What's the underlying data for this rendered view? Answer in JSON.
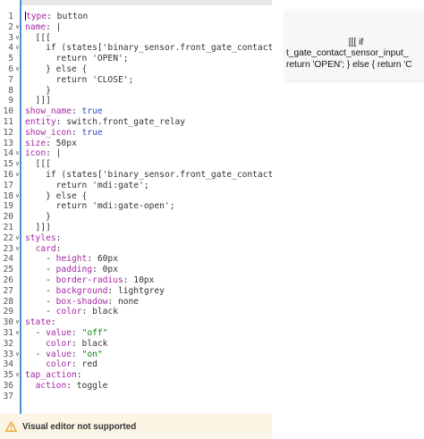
{
  "editor": {
    "lines": [
      {
        "n": "1",
        "fold": "",
        "parts": [
          [
            "k",
            "type"
          ],
          [
            "p",
            ": "
          ],
          [
            "p",
            "button"
          ]
        ],
        "cursor": true
      },
      {
        "n": "2",
        "fold": "v",
        "parts": [
          [
            "k",
            "name"
          ],
          [
            "p",
            ": |"
          ]
        ]
      },
      {
        "n": "3",
        "fold": "v",
        "parts": [
          [
            "p",
            "  [[["
          ]
        ]
      },
      {
        "n": "4",
        "fold": "v",
        "parts": [
          [
            "p",
            "    if (states['binary_sensor.front_gate_contact_s"
          ]
        ]
      },
      {
        "n": "5",
        "fold": "",
        "parts": [
          [
            "p",
            "      return 'OPEN';"
          ]
        ]
      },
      {
        "n": "6",
        "fold": "v",
        "parts": [
          [
            "p",
            "    } else {"
          ]
        ]
      },
      {
        "n": "7",
        "fold": "",
        "parts": [
          [
            "p",
            "      return 'CLOSE';"
          ]
        ]
      },
      {
        "n": "8",
        "fold": "",
        "parts": [
          [
            "p",
            "    }"
          ]
        ]
      },
      {
        "n": "9",
        "fold": "",
        "parts": [
          [
            "p",
            "  ]]]"
          ]
        ]
      },
      {
        "n": "10",
        "fold": "",
        "parts": [
          [
            "k",
            "show_name"
          ],
          [
            "p",
            ": "
          ],
          [
            "b",
            "true"
          ]
        ]
      },
      {
        "n": "11",
        "fold": "",
        "parts": [
          [
            "k",
            "entity"
          ],
          [
            "p",
            ": switch.front_gate_relay"
          ]
        ]
      },
      {
        "n": "12",
        "fold": "",
        "parts": [
          [
            "k",
            "show_icon"
          ],
          [
            "p",
            ": "
          ],
          [
            "b",
            "true"
          ]
        ]
      },
      {
        "n": "13",
        "fold": "",
        "parts": [
          [
            "k",
            "size"
          ],
          [
            "p",
            ": 50px"
          ]
        ]
      },
      {
        "n": "14",
        "fold": "v",
        "parts": [
          [
            "k",
            "icon"
          ],
          [
            "p",
            ": |"
          ]
        ]
      },
      {
        "n": "15",
        "fold": "v",
        "parts": [
          [
            "p",
            "  [[["
          ]
        ]
      },
      {
        "n": "16",
        "fold": "v",
        "parts": [
          [
            "p",
            "    if (states['binary_sensor.front_gate_contact_s"
          ]
        ]
      },
      {
        "n": "17",
        "fold": "",
        "parts": [
          [
            "p",
            "      return 'mdi:gate';"
          ]
        ]
      },
      {
        "n": "18",
        "fold": "v",
        "parts": [
          [
            "p",
            "    } else {"
          ]
        ]
      },
      {
        "n": "19",
        "fold": "",
        "parts": [
          [
            "p",
            "      return 'mdi:gate-open';"
          ]
        ]
      },
      {
        "n": "20",
        "fold": "",
        "parts": [
          [
            "p",
            "    }"
          ]
        ]
      },
      {
        "n": "21",
        "fold": "",
        "parts": [
          [
            "p",
            "  ]]]"
          ]
        ]
      },
      {
        "n": "22",
        "fold": "v",
        "parts": [
          [
            "k",
            "styles"
          ],
          [
            "p",
            ":"
          ]
        ]
      },
      {
        "n": "23",
        "fold": "v",
        "parts": [
          [
            "p",
            "  "
          ],
          [
            "k",
            "card"
          ],
          [
            "p",
            ":"
          ]
        ]
      },
      {
        "n": "24",
        "fold": "",
        "parts": [
          [
            "p",
            "    - "
          ],
          [
            "k",
            "height"
          ],
          [
            "p",
            ": 60px"
          ]
        ]
      },
      {
        "n": "25",
        "fold": "",
        "parts": [
          [
            "p",
            "    - "
          ],
          [
            "k",
            "padding"
          ],
          [
            "p",
            ": 0px"
          ]
        ]
      },
      {
        "n": "26",
        "fold": "",
        "parts": [
          [
            "p",
            "    - "
          ],
          [
            "k",
            "border-radius"
          ],
          [
            "p",
            ": 10px"
          ]
        ]
      },
      {
        "n": "27",
        "fold": "",
        "parts": [
          [
            "p",
            "    - "
          ],
          [
            "k",
            "background"
          ],
          [
            "p",
            ": lightgrey"
          ]
        ]
      },
      {
        "n": "28",
        "fold": "",
        "parts": [
          [
            "p",
            "    - "
          ],
          [
            "k",
            "box-shadow"
          ],
          [
            "p",
            ": none"
          ]
        ]
      },
      {
        "n": "29",
        "fold": "",
        "parts": [
          [
            "p",
            "    - "
          ],
          [
            "k",
            "color"
          ],
          [
            "p",
            ": black"
          ]
        ]
      },
      {
        "n": "30",
        "fold": "v",
        "parts": [
          [
            "k",
            "state"
          ],
          [
            "p",
            ":"
          ]
        ]
      },
      {
        "n": "31",
        "fold": "v",
        "parts": [
          [
            "p",
            "  - "
          ],
          [
            "k",
            "value"
          ],
          [
            "p",
            ": "
          ],
          [
            "s",
            "\"off\""
          ]
        ]
      },
      {
        "n": "32",
        "fold": "",
        "parts": [
          [
            "p",
            "    "
          ],
          [
            "k",
            "color"
          ],
          [
            "p",
            ": black"
          ]
        ]
      },
      {
        "n": "33",
        "fold": "v",
        "parts": [
          [
            "p",
            "  - "
          ],
          [
            "k",
            "value"
          ],
          [
            "p",
            ": "
          ],
          [
            "s",
            "\"on\""
          ]
        ]
      },
      {
        "n": "34",
        "fold": "",
        "parts": [
          [
            "p",
            "    "
          ],
          [
            "k",
            "color"
          ],
          [
            "p",
            ": red"
          ]
        ]
      },
      {
        "n": "35",
        "fold": "v",
        "parts": [
          [
            "k",
            "tap_action"
          ],
          [
            "p",
            ":"
          ]
        ]
      },
      {
        "n": "36",
        "fold": "",
        "parts": [
          [
            "p",
            "  "
          ],
          [
            "k",
            "action"
          ],
          [
            "p",
            ": toggle"
          ]
        ]
      },
      {
        "n": "37",
        "fold": "",
        "parts": []
      }
    ]
  },
  "warning": {
    "text": "Visual editor not supported",
    "icon": "warning-triangle-icon",
    "icon_color": "#f0a32a"
  },
  "preview": {
    "line1": "[[[ if",
    "line2": "t_gate_contact_sensor_input_",
    "line3": "return 'OPEN'; } else { return 'C"
  },
  "colors": {
    "gutter_border": "#4a90d9",
    "key": "#a626a4",
    "string": "#0a7d11",
    "bool": "#2c4fbf",
    "warning_bg": "#fcf5e6"
  }
}
